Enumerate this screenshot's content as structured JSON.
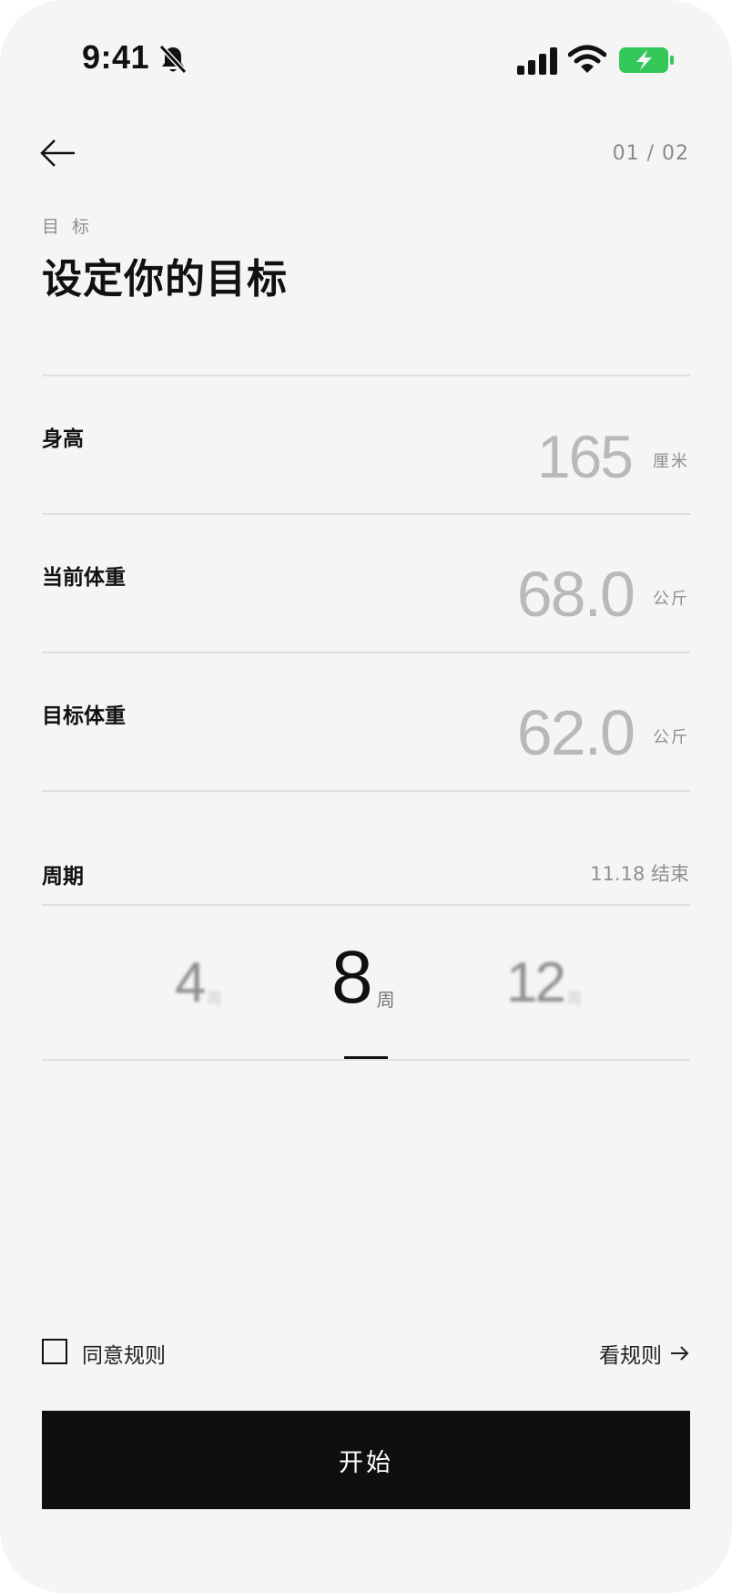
{
  "status_bar": {
    "time": "9:41"
  },
  "header": {
    "step_counter": "01 / 02"
  },
  "page": {
    "eyebrow": "目 标",
    "title": "设定你的目标"
  },
  "fields": [
    {
      "label": "身高",
      "value": "165",
      "unit": "厘米"
    },
    {
      "label": "当前体重",
      "value": "68.0",
      "unit": "公斤"
    },
    {
      "label": "目标体重",
      "value": "62.0",
      "unit": "公斤"
    }
  ],
  "period": {
    "label": "周期",
    "end_text": "11.18 结束",
    "options": [
      {
        "value": "4",
        "unit": "周"
      },
      {
        "value": "8",
        "unit": "周"
      },
      {
        "value": "12",
        "unit": "周"
      }
    ],
    "selected": "8"
  },
  "footer": {
    "agree_label": "同意规则",
    "agree_checked": false,
    "rules_link": "看规则",
    "start_button": "开始"
  },
  "colors": {
    "battery_green": "#34c759",
    "button_black": "#0f0f0f",
    "background": "#f5f5f3"
  }
}
